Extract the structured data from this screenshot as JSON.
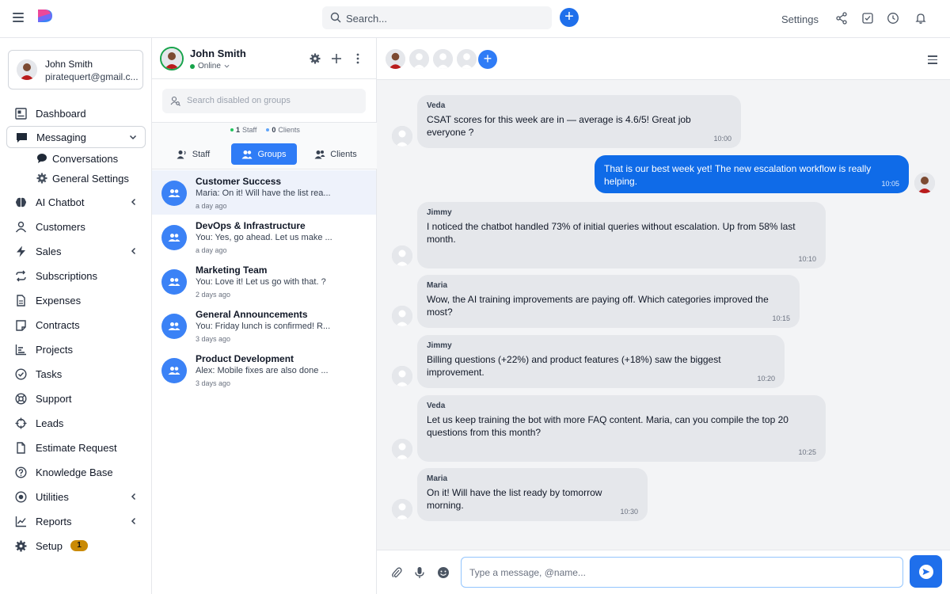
{
  "topbar": {
    "search_placeholder": "Search...",
    "settings_label": "Settings"
  },
  "colors": {
    "accent": "#1f6feb",
    "online": "#16a34a",
    "badge": "#ca8a04"
  },
  "sidebar": {
    "user": {
      "name": "John Smith",
      "email": "piratequert@gmail.c..."
    },
    "items": [
      {
        "label": "Dashboard",
        "icon": "dashboard-icon"
      },
      {
        "label": "Messaging",
        "icon": "chat-icon"
      },
      {
        "label": "AI Chatbot",
        "icon": "brain-icon"
      },
      {
        "label": "Customers",
        "icon": "user-icon"
      },
      {
        "label": "Sales",
        "icon": "bolt-icon"
      },
      {
        "label": "Subscriptions",
        "icon": "repeat-icon"
      },
      {
        "label": "Expenses",
        "icon": "file-icon"
      },
      {
        "label": "Contracts",
        "icon": "note-icon"
      },
      {
        "label": "Projects",
        "icon": "chart-icon"
      },
      {
        "label": "Tasks",
        "icon": "check-circle-icon"
      },
      {
        "label": "Support",
        "icon": "lifebuoy-icon"
      },
      {
        "label": "Leads",
        "icon": "crosshair-icon"
      },
      {
        "label": "Estimate Request",
        "icon": "document-icon"
      },
      {
        "label": "Knowledge Base",
        "icon": "question-icon"
      },
      {
        "label": "Utilities",
        "icon": "target-icon"
      },
      {
        "label": "Reports",
        "icon": "line-chart-icon"
      },
      {
        "label": "Setup",
        "icon": "gear-icon",
        "badge": "1"
      }
    ],
    "subitems": [
      {
        "label": "Conversations",
        "icon": "conversations-icon"
      },
      {
        "label": "General Settings",
        "icon": "gear-icon"
      }
    ]
  },
  "convpanel": {
    "user_name": "John Smith",
    "status": "Online",
    "search_placeholder": "Search disabled on groups",
    "counts": {
      "staff_num": "1",
      "staff_label": "Staff",
      "clients_num": "0",
      "clients_label": "Clients"
    },
    "tabs": [
      {
        "label": "Staff"
      },
      {
        "label": "Groups"
      },
      {
        "label": "Clients"
      }
    ],
    "conversations": [
      {
        "title": "Customer Success",
        "preview": "Maria: On it! Will have the list rea...",
        "time": "a day ago"
      },
      {
        "title": "DevOps & Infrastructure",
        "preview": "You: Yes, go ahead. Let us make ...",
        "time": "a day ago"
      },
      {
        "title": "Marketing Team",
        "preview": "You: Love it! Let us go with that. ?",
        "time": "2 days ago"
      },
      {
        "title": "General Announcements",
        "preview": "You: Friday lunch is confirmed! R...",
        "time": "3 days ago"
      },
      {
        "title": "Product Development",
        "preview": "Alex: Mobile fixes are also done ...",
        "time": "3 days ago"
      }
    ]
  },
  "chat": {
    "messages": [
      {
        "sender": "Veda",
        "text": "CSAT scores for this week are in — average is 4.6/5! Great job everyone ?",
        "time": "10:00"
      },
      {
        "sender": "",
        "text": "That is our best week yet! The new escalation workflow is really helping.",
        "time": "10:05"
      },
      {
        "sender": "Jimmy",
        "text": "I noticed the chatbot handled 73% of initial queries without escalation. Up from 58% last month.",
        "time": "10:10"
      },
      {
        "sender": "Maria",
        "text": "Wow, the AI training improvements are paying off. Which categories improved the most?",
        "time": "10:15"
      },
      {
        "sender": "Jimmy",
        "text": "Billing questions (+22%) and product features (+18%) saw the biggest improvement.",
        "time": "10:20"
      },
      {
        "sender": "Veda",
        "text": "Let us keep training the bot with more FAQ content. Maria, can you compile the top 20 questions from this month?",
        "time": "10:25"
      },
      {
        "sender": "Maria",
        "text": "On it! Will have the list ready by tomorrow morning.",
        "time": "10:30"
      }
    ],
    "composer_placeholder": "Type a message, @name..."
  }
}
